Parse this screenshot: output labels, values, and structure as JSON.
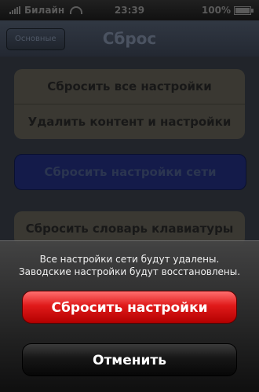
{
  "status_bar": {
    "carrier": "Билайн",
    "time": "23:39",
    "battery": "100%",
    "battery_level": 1
  },
  "navbar": {
    "back_label": "Основные",
    "title": "Сброс"
  },
  "settings": {
    "items": [
      {
        "label": "Сбросить все настройки"
      },
      {
        "label": "Удалить контент и настройки"
      },
      {
        "label": "Сбросить настройки сети"
      },
      {
        "label": "Сбросить словарь клавиатуры"
      }
    ]
  },
  "action_sheet": {
    "message": [
      "Все настройки сети будут удалены.",
      "Заводские настройки будут восстановлены."
    ],
    "confirm_label": "Сбросить настройки",
    "cancel_label": "Отменить"
  },
  "colors": {
    "destructive": "#e01a1a",
    "sheet_background": "#222222",
    "nav_background": "#2b313b"
  },
  "icons": {
    "signal": "signal-bars-icon",
    "wifi": "wifi-icon",
    "battery": "battery-icon"
  }
}
